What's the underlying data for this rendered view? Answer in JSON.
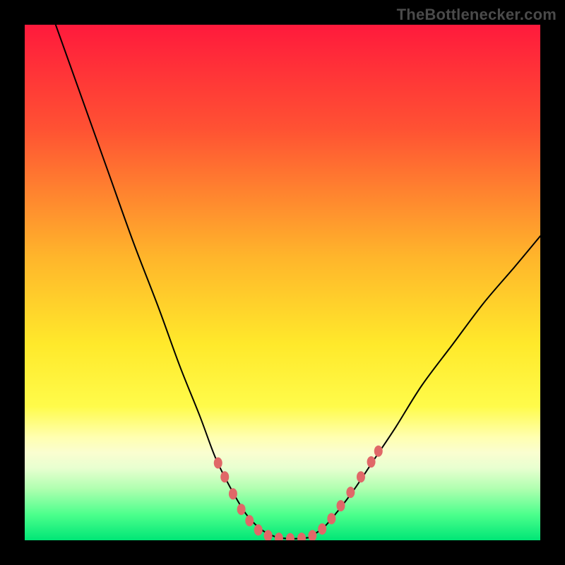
{
  "watermark": "TheBottlenecker.com",
  "chart_data": {
    "type": "line",
    "title": "",
    "xlabel": "",
    "ylabel": "",
    "xlim": [
      0,
      100
    ],
    "ylim": [
      0,
      100
    ],
    "background_gradient": {
      "stops": [
        {
          "offset": 0,
          "color": "#ff1a3c"
        },
        {
          "offset": 20,
          "color": "#ff5133"
        },
        {
          "offset": 45,
          "color": "#ffb52b"
        },
        {
          "offset": 62,
          "color": "#ffe92b"
        },
        {
          "offset": 74,
          "color": "#fffb4a"
        },
        {
          "offset": 80,
          "color": "#ffffb0"
        },
        {
          "offset": 83,
          "color": "#fafed0"
        },
        {
          "offset": 86,
          "color": "#e8ffd0"
        },
        {
          "offset": 90,
          "color": "#b0ffb0"
        },
        {
          "offset": 95,
          "color": "#4cff8c"
        },
        {
          "offset": 100,
          "color": "#00e676"
        }
      ]
    },
    "series": [
      {
        "name": "bottleneck_curve_left",
        "color": "#000000",
        "width": 2,
        "points": [
          {
            "x": 6,
            "y": 100
          },
          {
            "x": 11,
            "y": 86
          },
          {
            "x": 16,
            "y": 72
          },
          {
            "x": 21,
            "y": 58
          },
          {
            "x": 26,
            "y": 45
          },
          {
            "x": 30,
            "y": 34
          },
          {
            "x": 34,
            "y": 24
          },
          {
            "x": 37,
            "y": 16
          },
          {
            "x": 40,
            "y": 10
          },
          {
            "x": 43,
            "y": 5
          },
          {
            "x": 46,
            "y": 2
          },
          {
            "x": 49,
            "y": 0.5
          }
        ]
      },
      {
        "name": "bottleneck_curve_flat",
        "color": "#000000",
        "width": 2,
        "points": [
          {
            "x": 49,
            "y": 0.5
          },
          {
            "x": 52,
            "y": 0.3
          },
          {
            "x": 55,
            "y": 0.5
          }
        ]
      },
      {
        "name": "bottleneck_curve_right",
        "color": "#000000",
        "width": 2,
        "points": [
          {
            "x": 55,
            "y": 0.5
          },
          {
            "x": 58,
            "y": 2.5
          },
          {
            "x": 61,
            "y": 6
          },
          {
            "x": 64,
            "y": 10
          },
          {
            "x": 68,
            "y": 16
          },
          {
            "x": 72,
            "y": 22
          },
          {
            "x": 77,
            "y": 30
          },
          {
            "x": 83,
            "y": 38
          },
          {
            "x": 89,
            "y": 46
          },
          {
            "x": 95,
            "y": 53
          },
          {
            "x": 100,
            "y": 59
          }
        ]
      }
    ],
    "markers": {
      "name": "highlight_points",
      "color": "#e06868",
      "radius_x": 6,
      "radius_y": 8,
      "points": [
        {
          "x": 37.5,
          "y": 15
        },
        {
          "x": 38.8,
          "y": 12.3
        },
        {
          "x": 40.4,
          "y": 9
        },
        {
          "x": 42.0,
          "y": 6
        },
        {
          "x": 43.6,
          "y": 3.8
        },
        {
          "x": 45.3,
          "y": 2
        },
        {
          "x": 47.2,
          "y": 0.9
        },
        {
          "x": 49.3,
          "y": 0.4
        },
        {
          "x": 51.5,
          "y": 0.3
        },
        {
          "x": 53.7,
          "y": 0.4
        },
        {
          "x": 55.8,
          "y": 0.9
        },
        {
          "x": 57.7,
          "y": 2.2
        },
        {
          "x": 59.5,
          "y": 4.2
        },
        {
          "x": 61.3,
          "y": 6.7
        },
        {
          "x": 63.2,
          "y": 9.3
        },
        {
          "x": 65.2,
          "y": 12.3
        },
        {
          "x": 67.2,
          "y": 15.2
        },
        {
          "x": 68.6,
          "y": 17.3
        }
      ]
    }
  }
}
